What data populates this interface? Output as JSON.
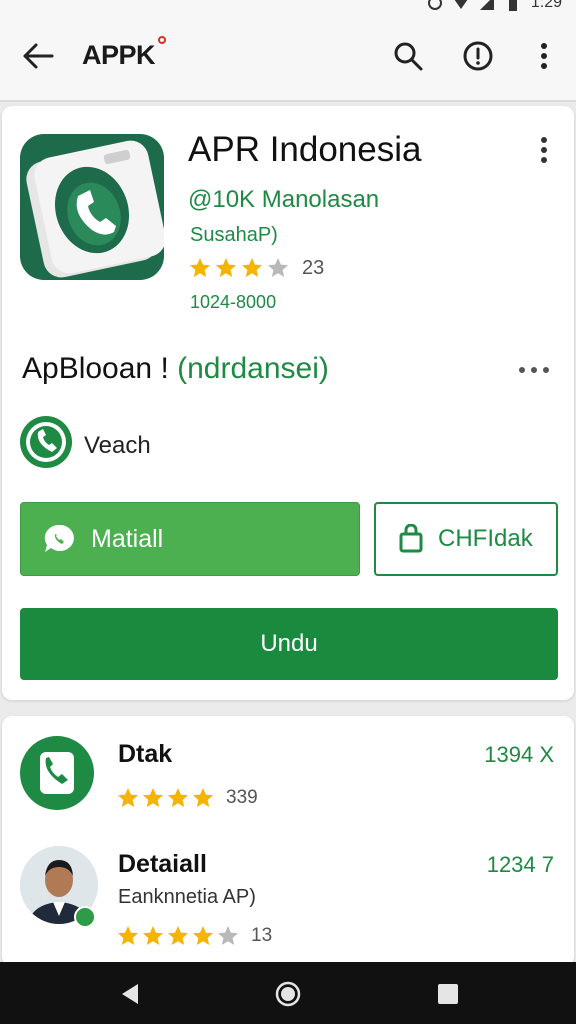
{
  "status_bar": {
    "time": "1:29"
  },
  "app_bar": {
    "title": "APPK"
  },
  "app": {
    "name": "APR Indonesia",
    "developer": "@10K Manolasan",
    "subtitle": "SusahaP)",
    "rating_count": "23",
    "downloads": "1024-8000",
    "stars_filled": 3
  },
  "section": {
    "title": "ApBlooan !",
    "subtitle": "(ndrdansei)"
  },
  "feature": {
    "label": "Veach"
  },
  "buttons": {
    "install": "Matiall",
    "secondary": "CHFIdak",
    "download": "Undu"
  },
  "list": [
    {
      "title": "Dtak",
      "value": "1394 X",
      "rating_count": "339",
      "stars_filled": 4
    },
    {
      "title": "Detaiall",
      "subtitle": "Eanknnetia AP)",
      "value": "1234 7",
      "rating_count": "13",
      "stars_filled": 4
    }
  ],
  "colors": {
    "brand_green": "#1e8a43",
    "install_green": "#4caf50",
    "star": "#f4b400",
    "star_empty": "#b9b9b9"
  }
}
